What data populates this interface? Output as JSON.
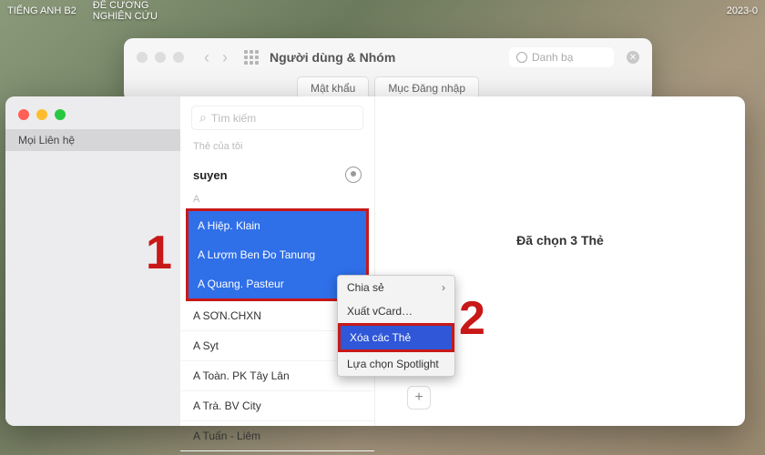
{
  "topbar": {
    "menu1": "TIẾNG ANH B2",
    "menu2": "ĐỀ CƯƠNG\nNGHIÊN CỨU",
    "timestamp": "2023-0"
  },
  "back_window": {
    "title": "Người dùng & Nhóm",
    "search_placeholder": "Danh bạ",
    "tab1": "Mật khẩu",
    "tab2": "Mục Đăng nhập"
  },
  "contacts": {
    "sidebar_item": "Mọi Liên hệ",
    "search_placeholder": "Tìm kiếm",
    "my_card_label": "Thẻ của tôi",
    "my_name": "suyen",
    "group": "A",
    "selected": [
      "A Hiệp. Klain",
      "A Lượm Ben Đo Tanung",
      "A Quang. Pasteur"
    ],
    "rest": [
      "A SƠN.CHXN",
      "A Syt",
      "A Toàn. PK Tây Lân",
      "A Trà. BV City",
      "A Tuấn - Liêm"
    ],
    "detail_text": "Đã chọn 3 Thẻ",
    "add": "+"
  },
  "context_menu": {
    "items": [
      "Chia sẻ",
      "Xuất vCard…",
      "Xóa các Thẻ",
      "Lựa chọn Spotlight"
    ],
    "highlighted_index": 2,
    "has_submenu_index": 0
  },
  "annotations": {
    "one": "1",
    "two": "2"
  }
}
